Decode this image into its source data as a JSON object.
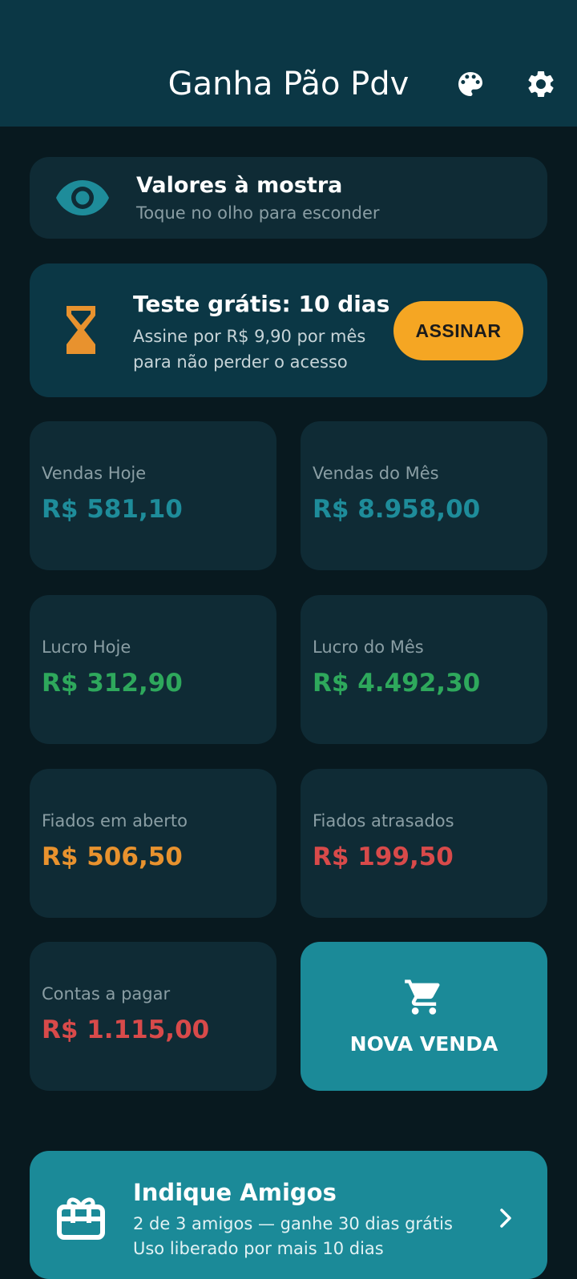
{
  "header": {
    "title": "Ganha Pão Pdv",
    "palette_icon": "palette-icon",
    "settings_icon": "gear-icon"
  },
  "visibility": {
    "title": "Valores à mostra",
    "subtitle": "Toque no olho para esconder",
    "icon": "eye-icon"
  },
  "trial": {
    "title": "Teste grátis: 10 dias",
    "line1": "Assine por R$ 9,90 por mês",
    "line2": "para não perder o acesso",
    "button": "ASSINAR",
    "icon": "hourglass-icon"
  },
  "stats": [
    {
      "label": "Vendas Hoje",
      "value": "R$ 581,10",
      "color": "#1e8c9a"
    },
    {
      "label": "Vendas do Mês",
      "value": "R$ 8.958,00",
      "color": "#1e8c9a"
    },
    {
      "label": "Lucro Hoje",
      "value": "R$ 312,90",
      "color": "#2ea85c"
    },
    {
      "label": "Lucro do Mês",
      "value": "R$ 4.492,30",
      "color": "#2ea85c"
    },
    {
      "label": "Fiados em aberto",
      "value": "R$ 506,50",
      "color": "#e8922e"
    },
    {
      "label": "Fiados atrasados",
      "value": "R$ 199,50",
      "color": "#d84a4a"
    },
    {
      "label": "Contas a pagar",
      "value": "R$ 1.115,00",
      "color": "#d84a4a"
    }
  ],
  "new_sale": {
    "label": "NOVA VENDA",
    "icon": "cart-icon"
  },
  "referral": {
    "title": "Indique Amigos",
    "line1": "2 de 3 amigos — ganhe 30 dias grátis",
    "line2": "Uso liberado por mais 10 dias",
    "icon": "gift-icon"
  },
  "colors": {
    "appbar": "#0b3745",
    "background": "#08191f",
    "card": "#0f2b35",
    "accent": "#1b8a98",
    "button": "#f5a623"
  }
}
